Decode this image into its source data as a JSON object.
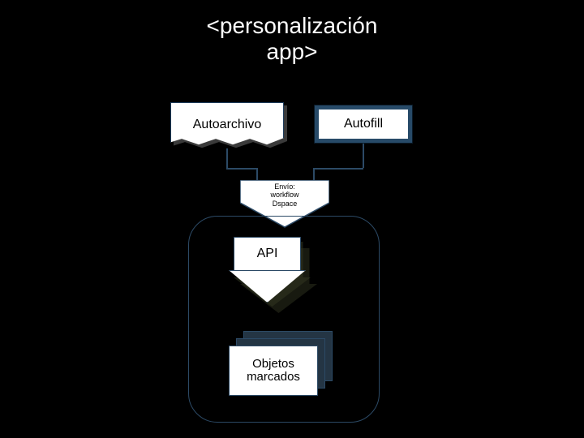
{
  "title_line1": "<personalización",
  "title_line2": "app>",
  "autoarchivo": "Autoarchivo",
  "autofill": "Autofill",
  "envio_line1": "Envío:",
  "envio_line2": "workflow",
  "envio_line3": "Dspace",
  "api": "API",
  "objetos_line1": "Objetos",
  "objetos_line2": "marcados"
}
